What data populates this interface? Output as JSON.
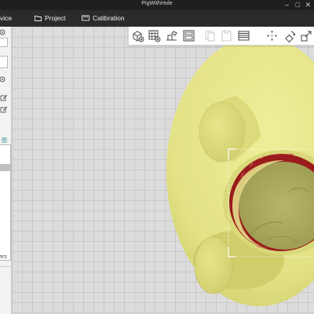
{
  "window": {
    "title": "PigWithHole",
    "controls": [
      "minimize-button",
      "maximize-button",
      "close-button"
    ]
  },
  "menu": {
    "items": [
      {
        "label": "vice",
        "icon": "device-icon"
      },
      {
        "label": "Project",
        "icon": "folder-icon"
      },
      {
        "label": "Calibration",
        "icon": "calibration-icon"
      }
    ]
  },
  "left_panel": {
    "partial_label": "图",
    "bottom_label": "ers"
  },
  "toolbar": {
    "buttons": [
      {
        "name": "add-model-button",
        "icon": "cube-add-icon",
        "enabled": true
      },
      {
        "name": "add-grid-button",
        "icon": "grid-icon",
        "enabled": true
      },
      {
        "name": "auto-arrange-button",
        "icon": "arrange-icon",
        "enabled": true
      },
      {
        "name": "layout-button",
        "icon": "layout-icon",
        "enabled": true
      },
      {
        "name": "copy-button",
        "icon": "copy-icon",
        "enabled": false
      },
      {
        "name": "paste-button",
        "icon": "paste-icon",
        "enabled": false
      },
      {
        "name": "layers-button",
        "icon": "layers-icon",
        "enabled": true
      },
      {
        "name": "move-button",
        "icon": "move-icon",
        "enabled": true
      },
      {
        "name": "rotate-button",
        "icon": "rotate-icon",
        "enabled": true
      },
      {
        "name": "scale-button",
        "icon": "scale-icon",
        "enabled": true
      }
    ]
  },
  "colors": {
    "model": "#e6e58a",
    "model_shadow": "#bdbc5f",
    "hole_rim": "#9a1c1c",
    "selection": "#ffffff"
  }
}
